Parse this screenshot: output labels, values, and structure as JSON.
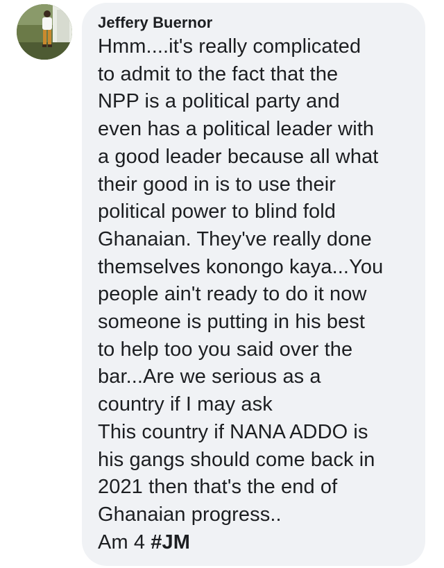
{
  "comment": {
    "author": "Jeffery Buernor",
    "lines": [
      "Hmm....it's really complicated",
      "to admit to the fact that the",
      "NPP is a political party and",
      "even has a political leader with",
      "a good leader because all what",
      "their good in is to use their",
      "political power to blind fold",
      "Ghanaian. They've really done",
      "themselves konongo kaya...You",
      "people ain't ready to do it now",
      "someone is putting in his best",
      "to help too you said over the",
      "bar...Are we serious as a",
      "country if I may ask",
      "This country if NANA ADDO is",
      "his gangs should come back in",
      "2021 then that's the end of",
      "Ghanaian progress.."
    ],
    "last_line_prefix": "Am 4 ",
    "hashtag": "#JM"
  },
  "colors": {
    "bubble_bg": "#f0f2f5",
    "text": "#1c1e21"
  },
  "icons": {
    "avatar": "profile-photo"
  }
}
